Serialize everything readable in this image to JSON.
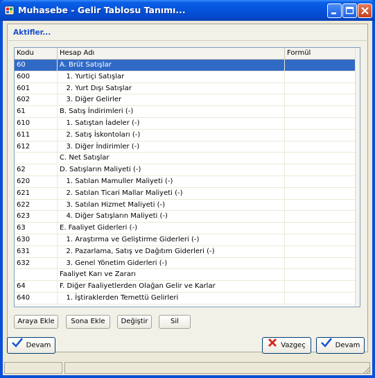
{
  "window": {
    "title": "Muhasebe - Gelir Tablosu Tanımı...",
    "icon": "accounting-app-icon"
  },
  "panel": {
    "title": "Aktifler..."
  },
  "table": {
    "columns": [
      "Kodu",
      "Hesap Adı",
      "Formül"
    ],
    "rows": [
      {
        "kod": "60",
        "ad": "A. Brüt Satışlar",
        "formul": "",
        "selected": true
      },
      {
        "kod": "600",
        "ad": "   1. Yurtiçi Satışlar",
        "formul": ""
      },
      {
        "kod": "601",
        "ad": "   2. Yurt Dışı Satışlar",
        "formul": ""
      },
      {
        "kod": "602",
        "ad": "   3. Diğer Gelirler",
        "formul": ""
      },
      {
        "kod": "61",
        "ad": "B. Satış İndirimleri (-)",
        "formul": ""
      },
      {
        "kod": "610",
        "ad": "   1. Satıştan İadeler (-)",
        "formul": ""
      },
      {
        "kod": "611",
        "ad": "   2. Satış İskontoları (-)",
        "formul": ""
      },
      {
        "kod": "612",
        "ad": "   3. Diğer İndirimler (-)",
        "formul": ""
      },
      {
        "kod": "",
        "ad": "C. Net Satışlar",
        "formul": ""
      },
      {
        "kod": "62",
        "ad": "D. Satışların Maliyeti (-)",
        "formul": ""
      },
      {
        "kod": "620",
        "ad": "   1. Satılan Mamuller Maliyeti (-)",
        "formul": ""
      },
      {
        "kod": "621",
        "ad": "   2. Satılan Ticari Mallar Maliyeti (-)",
        "formul": ""
      },
      {
        "kod": "622",
        "ad": "   3. Satılan Hizmet Maliyeti (-)",
        "formul": ""
      },
      {
        "kod": "623",
        "ad": "   4. Diğer Satışların Maliyeti (-)",
        "formul": ""
      },
      {
        "kod": "63",
        "ad": "E. Faaliyet Giderleri (-)",
        "formul": ""
      },
      {
        "kod": "630",
        "ad": "   1. Araştırma ve Geliştirme Giderleri (-)",
        "formul": ""
      },
      {
        "kod": "631",
        "ad": "   2. Pazarlama, Satış ve Dağıtım Giderleri (-)",
        "formul": ""
      },
      {
        "kod": "632",
        "ad": "   3. Genel Yönetim Giderleri (-)",
        "formul": ""
      },
      {
        "kod": "",
        "ad": "Faaliyet Karı ve Zararı",
        "formul": ""
      },
      {
        "kod": "64",
        "ad": "F. Diğer Faaliyetlerden Olağan Gelir ve Karlar",
        "formul": ""
      },
      {
        "kod": "640",
        "ad": "   1. İştiraklerden Temettü Gelirleri",
        "formul": ""
      }
    ]
  },
  "grid_buttons": {
    "araya_ekle": "Araya Ekle",
    "sona_ekle": "Sona Ekle",
    "degistir": "Değiştir",
    "sil": "Sil"
  },
  "footer_buttons": {
    "devam_left": "Devam",
    "vazgec": "Vazgeç",
    "devam_right": "Devam"
  },
  "colors": {
    "title_bar": "#0552d8",
    "selection": "#316ac5",
    "panel_title": "#1b4fc8"
  }
}
